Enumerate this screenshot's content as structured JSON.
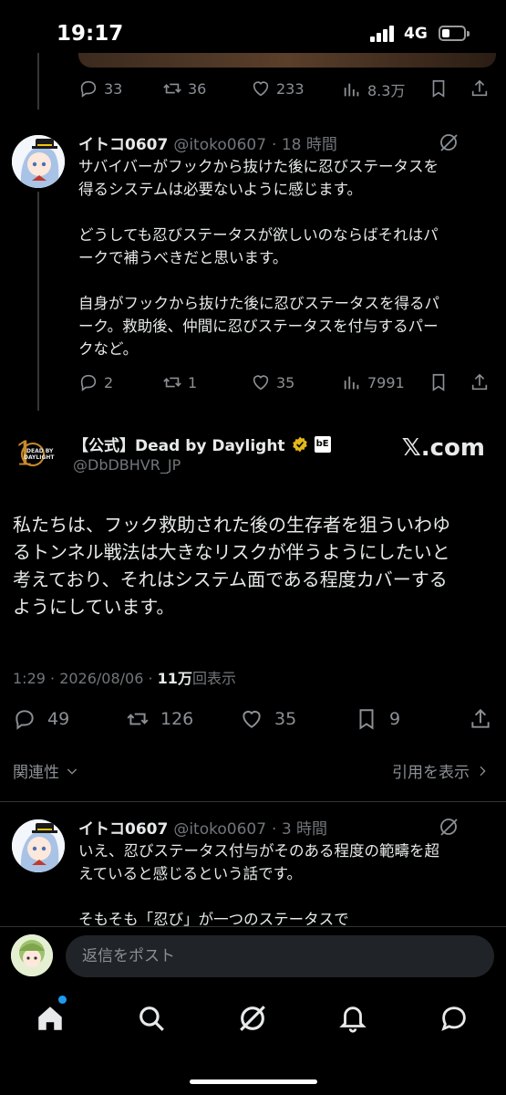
{
  "status": {
    "time": "19:17",
    "network": "4G",
    "battery_level": 0.35
  },
  "top_tweet_actions": {
    "replies": "33",
    "reposts": "36",
    "likes": "233",
    "views": "8.3万"
  },
  "reply1": {
    "name": "イトコ0607",
    "handle": "@itoko0607",
    "time": "· 18 時間",
    "text": "サバイバーがフックから抜けた後に忍びステータスを\n得るシステムは必要ないように感じます。\n\nどうしても忍びステータスが欲しいのならばそれはパ\nークで補うべきだと思います。\n\n自身がフックから抜けた後に忍びステータスを得るパ\nーク。救助後、仲間に忍びステータスを付与するパー\nクなど。",
    "actions": {
      "replies": "2",
      "reposts": "1",
      "likes": "35",
      "views": "7991"
    }
  },
  "main_tweet": {
    "name": "【公式】Dead by Daylight",
    "handle": "@DbDBHVR_JP",
    "logo_text": "DEAD BY\nDAYLIGHT",
    "badge_text": "bE",
    "source": "𝕏.com",
    "text": "私たちは、フック救助された後の生存者を狙ういわゆ\nるトンネル戦法は大きなリスクが伴うようにしたいと\n考えており、それはシステム面である程度カバーする\nようにしています。",
    "timestamp": "1:29 · 2026/08/06 · ",
    "views_count": "11万",
    "views_label": "回表示",
    "actions": {
      "replies": "49",
      "reposts": "126",
      "likes": "35",
      "bookmarks": "9"
    }
  },
  "sort": {
    "relevance": "関連性",
    "show_quotes": "引用を表示"
  },
  "reply2": {
    "name": "イトコ0607",
    "handle": "@itoko0607",
    "time": "· 3 時間",
    "text": "いえ、忍びステータス付与がそのある程度の範疇を超\nえていると感じるという話です。\n\nそもそも「忍び」が一つのステータスで"
  },
  "reply_bar": {
    "placeholder": "返信をポスト"
  },
  "colors": {
    "background": "#000000",
    "text": "#e7e9ea",
    "muted": "#71767b",
    "accent": "#1d9bf0",
    "verified": "#e2b719"
  },
  "nav": [
    "home-icon",
    "search-icon",
    "grok-icon",
    "notifications-icon",
    "messages-icon"
  ]
}
